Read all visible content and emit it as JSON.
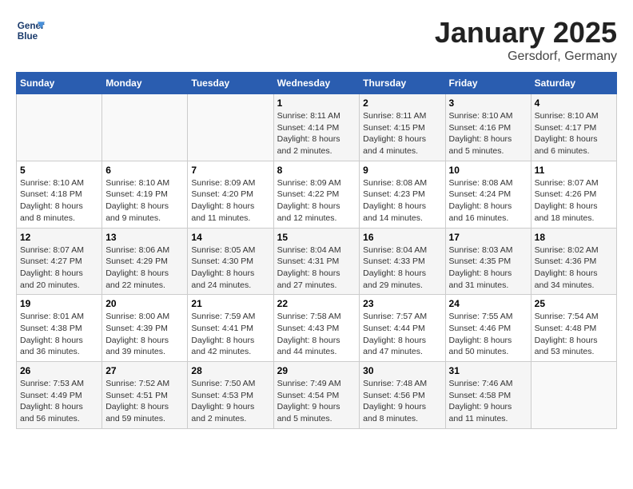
{
  "header": {
    "logo_line1": "General",
    "logo_line2": "Blue",
    "month": "January 2025",
    "location": "Gersdorf, Germany"
  },
  "days_of_week": [
    "Sunday",
    "Monday",
    "Tuesday",
    "Wednesday",
    "Thursday",
    "Friday",
    "Saturday"
  ],
  "weeks": [
    [
      {
        "num": "",
        "sunrise": "",
        "sunset": "",
        "daylight": ""
      },
      {
        "num": "",
        "sunrise": "",
        "sunset": "",
        "daylight": ""
      },
      {
        "num": "",
        "sunrise": "",
        "sunset": "",
        "daylight": ""
      },
      {
        "num": "1",
        "sunrise": "Sunrise: 8:11 AM",
        "sunset": "Sunset: 4:14 PM",
        "daylight": "Daylight: 8 hours and 2 minutes."
      },
      {
        "num": "2",
        "sunrise": "Sunrise: 8:11 AM",
        "sunset": "Sunset: 4:15 PM",
        "daylight": "Daylight: 8 hours and 4 minutes."
      },
      {
        "num": "3",
        "sunrise": "Sunrise: 8:10 AM",
        "sunset": "Sunset: 4:16 PM",
        "daylight": "Daylight: 8 hours and 5 minutes."
      },
      {
        "num": "4",
        "sunrise": "Sunrise: 8:10 AM",
        "sunset": "Sunset: 4:17 PM",
        "daylight": "Daylight: 8 hours and 6 minutes."
      }
    ],
    [
      {
        "num": "5",
        "sunrise": "Sunrise: 8:10 AM",
        "sunset": "Sunset: 4:18 PM",
        "daylight": "Daylight: 8 hours and 8 minutes."
      },
      {
        "num": "6",
        "sunrise": "Sunrise: 8:10 AM",
        "sunset": "Sunset: 4:19 PM",
        "daylight": "Daylight: 8 hours and 9 minutes."
      },
      {
        "num": "7",
        "sunrise": "Sunrise: 8:09 AM",
        "sunset": "Sunset: 4:20 PM",
        "daylight": "Daylight: 8 hours and 11 minutes."
      },
      {
        "num": "8",
        "sunrise": "Sunrise: 8:09 AM",
        "sunset": "Sunset: 4:22 PM",
        "daylight": "Daylight: 8 hours and 12 minutes."
      },
      {
        "num": "9",
        "sunrise": "Sunrise: 8:08 AM",
        "sunset": "Sunset: 4:23 PM",
        "daylight": "Daylight: 8 hours and 14 minutes."
      },
      {
        "num": "10",
        "sunrise": "Sunrise: 8:08 AM",
        "sunset": "Sunset: 4:24 PM",
        "daylight": "Daylight: 8 hours and 16 minutes."
      },
      {
        "num": "11",
        "sunrise": "Sunrise: 8:07 AM",
        "sunset": "Sunset: 4:26 PM",
        "daylight": "Daylight: 8 hours and 18 minutes."
      }
    ],
    [
      {
        "num": "12",
        "sunrise": "Sunrise: 8:07 AM",
        "sunset": "Sunset: 4:27 PM",
        "daylight": "Daylight: 8 hours and 20 minutes."
      },
      {
        "num": "13",
        "sunrise": "Sunrise: 8:06 AM",
        "sunset": "Sunset: 4:29 PM",
        "daylight": "Daylight: 8 hours and 22 minutes."
      },
      {
        "num": "14",
        "sunrise": "Sunrise: 8:05 AM",
        "sunset": "Sunset: 4:30 PM",
        "daylight": "Daylight: 8 hours and 24 minutes."
      },
      {
        "num": "15",
        "sunrise": "Sunrise: 8:04 AM",
        "sunset": "Sunset: 4:31 PM",
        "daylight": "Daylight: 8 hours and 27 minutes."
      },
      {
        "num": "16",
        "sunrise": "Sunrise: 8:04 AM",
        "sunset": "Sunset: 4:33 PM",
        "daylight": "Daylight: 8 hours and 29 minutes."
      },
      {
        "num": "17",
        "sunrise": "Sunrise: 8:03 AM",
        "sunset": "Sunset: 4:35 PM",
        "daylight": "Daylight: 8 hours and 31 minutes."
      },
      {
        "num": "18",
        "sunrise": "Sunrise: 8:02 AM",
        "sunset": "Sunset: 4:36 PM",
        "daylight": "Daylight: 8 hours and 34 minutes."
      }
    ],
    [
      {
        "num": "19",
        "sunrise": "Sunrise: 8:01 AM",
        "sunset": "Sunset: 4:38 PM",
        "daylight": "Daylight: 8 hours and 36 minutes."
      },
      {
        "num": "20",
        "sunrise": "Sunrise: 8:00 AM",
        "sunset": "Sunset: 4:39 PM",
        "daylight": "Daylight: 8 hours and 39 minutes."
      },
      {
        "num": "21",
        "sunrise": "Sunrise: 7:59 AM",
        "sunset": "Sunset: 4:41 PM",
        "daylight": "Daylight: 8 hours and 42 minutes."
      },
      {
        "num": "22",
        "sunrise": "Sunrise: 7:58 AM",
        "sunset": "Sunset: 4:43 PM",
        "daylight": "Daylight: 8 hours and 44 minutes."
      },
      {
        "num": "23",
        "sunrise": "Sunrise: 7:57 AM",
        "sunset": "Sunset: 4:44 PM",
        "daylight": "Daylight: 8 hours and 47 minutes."
      },
      {
        "num": "24",
        "sunrise": "Sunrise: 7:55 AM",
        "sunset": "Sunset: 4:46 PM",
        "daylight": "Daylight: 8 hours and 50 minutes."
      },
      {
        "num": "25",
        "sunrise": "Sunrise: 7:54 AM",
        "sunset": "Sunset: 4:48 PM",
        "daylight": "Daylight: 8 hours and 53 minutes."
      }
    ],
    [
      {
        "num": "26",
        "sunrise": "Sunrise: 7:53 AM",
        "sunset": "Sunset: 4:49 PM",
        "daylight": "Daylight: 8 hours and 56 minutes."
      },
      {
        "num": "27",
        "sunrise": "Sunrise: 7:52 AM",
        "sunset": "Sunset: 4:51 PM",
        "daylight": "Daylight: 8 hours and 59 minutes."
      },
      {
        "num": "28",
        "sunrise": "Sunrise: 7:50 AM",
        "sunset": "Sunset: 4:53 PM",
        "daylight": "Daylight: 9 hours and 2 minutes."
      },
      {
        "num": "29",
        "sunrise": "Sunrise: 7:49 AM",
        "sunset": "Sunset: 4:54 PM",
        "daylight": "Daylight: 9 hours and 5 minutes."
      },
      {
        "num": "30",
        "sunrise": "Sunrise: 7:48 AM",
        "sunset": "Sunset: 4:56 PM",
        "daylight": "Daylight: 9 hours and 8 minutes."
      },
      {
        "num": "31",
        "sunrise": "Sunrise: 7:46 AM",
        "sunset": "Sunset: 4:58 PM",
        "daylight": "Daylight: 9 hours and 11 minutes."
      },
      {
        "num": "",
        "sunrise": "",
        "sunset": "",
        "daylight": ""
      }
    ]
  ]
}
